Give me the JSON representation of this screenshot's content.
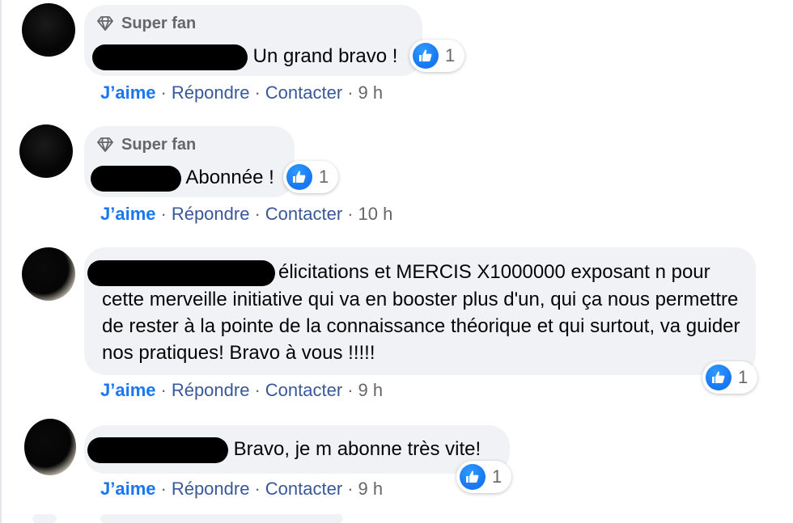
{
  "comments": [
    {
      "badge": "Super fan",
      "text": "Un grand bravo !",
      "reaction_count": "1",
      "actions": {
        "like": "J’aime",
        "reply": "Répondre",
        "contact": "Contacter",
        "time": "9 h"
      }
    },
    {
      "badge": "Super fan",
      "text": "Abonnée !",
      "reaction_count": "1",
      "actions": {
        "like": "J’aime",
        "reply": "Répondre",
        "contact": "Contacter",
        "time": "10 h"
      }
    },
    {
      "text_first": "élicitations et MERCIS X1000000 exposant n pour",
      "text_rest": "cette merveille initiative qui va en booster plus d'un, qui ça nous permettre de rester à la pointe de la connaissance théorique et qui surtout, va guider nos pratiques! Bravo à vous !!!!!",
      "reaction_count": "1",
      "actions": {
        "like": "J’aime",
        "reply": "Répondre",
        "contact": "Contacter",
        "time": "9 h"
      }
    },
    {
      "text": "Bravo, je m abonne très vite!",
      "reaction_count": "1",
      "actions": {
        "like": "J’aime",
        "reply": "Répondre",
        "contact": "Contacter",
        "time": "9 h"
      }
    }
  ],
  "icons": {
    "badge": "diamond-icon",
    "reaction": "thumbs-up-icon"
  },
  "colors": {
    "bubble": "#f0f2f5",
    "like_action": "#1877f2",
    "link": "#385898",
    "meta": "#65676b",
    "like_badge": "#1877f2"
  }
}
